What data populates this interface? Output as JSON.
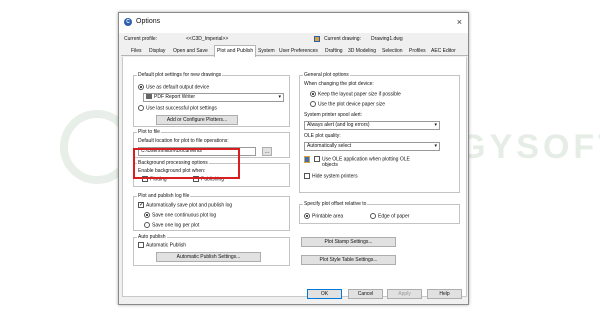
{
  "watermark": {
    "text": "SYNERGYSOFT"
  },
  "dialog": {
    "title": "Options",
    "close": "×",
    "current_profile_label": "Current profile:",
    "current_profile_value": "<<C3D_Imperial>>",
    "current_drawing_label": "Current drawing:",
    "current_drawing_value": "Drawing1.dwg"
  },
  "tabs": [
    "Files",
    "Display",
    "Open and Save",
    "Plot and Publish",
    "System",
    "User Preferences",
    "Drafting",
    "3D Modeling",
    "Selection",
    "Profiles",
    "AEC Editor"
  ],
  "active_tab_index": 3,
  "left": {
    "default_settings": {
      "title": "Default plot settings for new drawings",
      "use_default_device": "Use as default output device",
      "device_value": "PDF Report Writer",
      "use_last_successful": "Use last successful plot settings",
      "add_plotters_button": "Add or Configure Plotters..."
    },
    "plot_to_file": {
      "title": "Plot to file",
      "location_label": "Default location for plot to file operations:",
      "location_value": "C:\\Users\\mlibm\\Documents",
      "browse_button": "..."
    },
    "background": {
      "title": "Background processing options",
      "enable_label": "Enable background plot when:",
      "plotting": "Plotting",
      "publishing": "Publishing"
    },
    "log": {
      "title": "Plot and publish log file",
      "auto_save": "Automatically save plot and publish log",
      "one_continuous": "Save one continuous plot log",
      "one_per_plot": "Save one log per plot"
    },
    "auto_publish": {
      "title": "Auto publish",
      "checkbox": "Automatic Publish",
      "settings_button": "Automatic Publish Settings..."
    }
  },
  "right": {
    "general": {
      "title": "General plot options",
      "when_changing": "When changing the plot device:",
      "keep_layout": "Keep the layout paper size if possible",
      "use_device_paper": "Use the plot device paper size",
      "spool_label": "System printer spool alert:",
      "spool_value": "Always alert (and log errors)",
      "ole_quality_label": "OLE plot quality:",
      "ole_quality_value": "Automatically select",
      "use_ole_app_line1": "Use OLE application when plotting OLE",
      "use_ole_app_line2": "objects",
      "hide_printers": "Hide system printers"
    },
    "offset": {
      "title": "Specify plot offset relative to",
      "printable_area": "Printable area",
      "edge_of_paper": "Edge of paper"
    },
    "plot_stamp_button": "Plot Stamp Settings...",
    "plot_style_button": "Plot Style Table Settings..."
  },
  "footer": {
    "ok": "OK",
    "cancel": "Cancel",
    "apply": "Apply",
    "help": "Help"
  },
  "colors": {
    "highlight": "#d81e1e",
    "accent": "#0078d7"
  }
}
